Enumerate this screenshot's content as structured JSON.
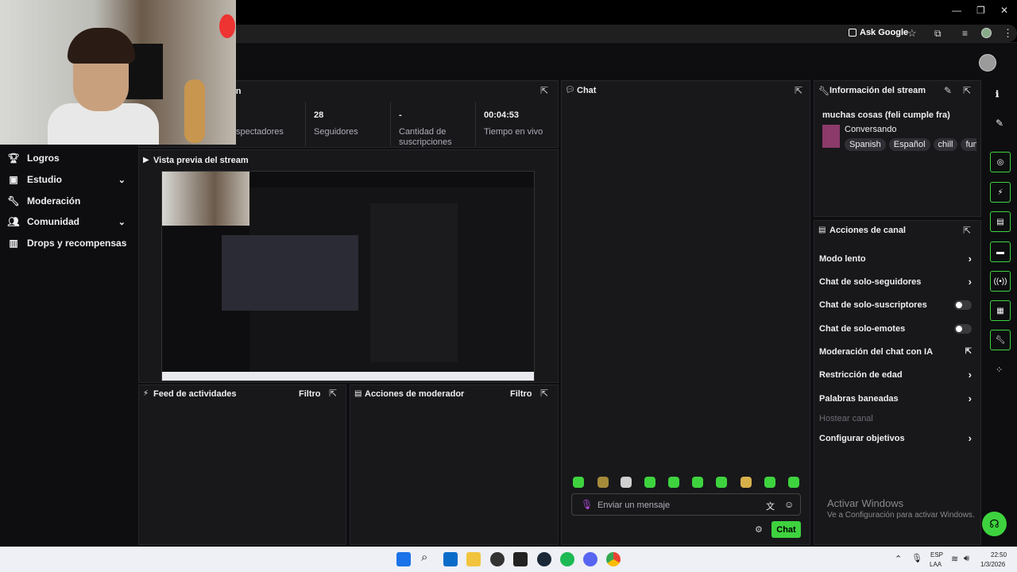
{
  "browser": {
    "ask_google": "Ask Google"
  },
  "nav": {
    "items": [
      {
        "label": "Logros",
        "icon": "trophy-icon",
        "chevron": false
      },
      {
        "label": "Estudio",
        "icon": "film-icon",
        "chevron": true
      },
      {
        "label": "Moderación",
        "icon": "wrench-icon",
        "chevron": false
      },
      {
        "label": "Comunidad",
        "icon": "people-icon",
        "chevron": true
      },
      {
        "label": "Drops y recompensas",
        "icon": "gift-icon",
        "chevron": false
      }
    ]
  },
  "stats": {
    "title_fragment": "on",
    "items": [
      {
        "value": "",
        "label": "spectadores"
      },
      {
        "value": "28",
        "label": "Seguidores"
      },
      {
        "value": "-",
        "label": "Cantidad de suscripciones"
      },
      {
        "value": "00:04:53",
        "label": "Tiempo en vivo"
      }
    ]
  },
  "preview": {
    "title": "Vista previa del stream"
  },
  "feed": {
    "title": "Feed de actividades",
    "filter": "Filtro"
  },
  "mod_actions": {
    "title": "Acciones de moderador",
    "filter": "Filtro"
  },
  "chat": {
    "title": "Chat",
    "placeholder": "Enviar un mensaje",
    "send_label": "Chat"
  },
  "stream_info": {
    "title": "Información del stream",
    "stream_title": "muchas cosas (feli cumple fra)",
    "category": "Conversando",
    "tags": [
      "Spanish",
      "Español",
      "chill",
      "funn"
    ]
  },
  "channel_actions": {
    "title": "Acciones de canal",
    "items": [
      {
        "label": "Modo lento",
        "control": "arrow"
      },
      {
        "label": "Chat de solo-seguidores",
        "control": "arrow"
      },
      {
        "label": "Chat de solo-suscriptores",
        "control": "toggle"
      },
      {
        "label": "Chat de solo-emotes",
        "control": "toggle"
      },
      {
        "label": "Moderación del chat con IA",
        "control": "external"
      },
      {
        "label": "Restricción de edad",
        "control": "arrow"
      },
      {
        "label": "Palabras baneadas",
        "control": "arrow"
      },
      {
        "label": "Hostear canal",
        "control": "disabled"
      },
      {
        "label": "Configurar objetivos",
        "control": "arrow"
      }
    ]
  },
  "watermark": {
    "line1": "Activar Windows",
    "line2": "Ve a Configuración para activar Windows."
  },
  "taskbar": {
    "lang1": "ESP",
    "lang2": "LAA",
    "time": "22:50",
    "date": "1/3/2026"
  },
  "colors": {
    "accent": "#3ed33e",
    "panel": "#18181b",
    "bg": "#0e0e10"
  }
}
